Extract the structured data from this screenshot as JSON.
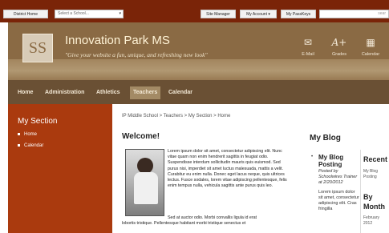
{
  "topbar": {
    "district_home": "District Home",
    "select_school_placeholder": "Select a School...",
    "site_manager": "Site Manager",
    "my_account": "My Account",
    "my_passkeys": "My PassKeys",
    "search_label": "sear"
  },
  "header": {
    "logo_text": "SS",
    "site_title": "Innovation Park MS",
    "tagline": "\"Give your website a fun, unique, and refreshing new look\"",
    "icons": [
      {
        "name": "email-icon",
        "label": "E-Mail"
      },
      {
        "name": "grades-icon",
        "label": "Grades"
      },
      {
        "name": "calendar-icon",
        "label": "Calendar"
      }
    ]
  },
  "nav": {
    "items": [
      {
        "label": "Home"
      },
      {
        "label": "Administration"
      },
      {
        "label": "Athletics"
      },
      {
        "label": "Teachers",
        "active": true
      },
      {
        "label": "Calendar"
      }
    ]
  },
  "sidebar": {
    "title": "My Section",
    "items": [
      {
        "label": "Home"
      },
      {
        "label": "Calendar"
      }
    ]
  },
  "main": {
    "breadcrumb": "IP Middle School > Teachers > My Section > Home",
    "welcome": "Welcome!",
    "paragraph1": "Lorem ipsum dolor sit amet, consectetur adipiscing elit. Nunc vitae quam non enim hendrerit sagittis in feugiat odio. Suspendisse interdum sollicitudin mauris quis euismod. Sed purus nisi, imperdiet sit amet luctus malesuada, mattis a velit. Curabitur eu enim nulla. Donec eget lacus neque, quis ultrices lectus. Fusce sodales, lorem vitae adipiscing pellentesque, felis enim tempus nulla, vehicula sagittis ante purus quis leo.",
    "paragraph2": "Sed at auctor odio. Morbi convallis ligula id erat",
    "paragraph3": "lobortis tristique. Pellentesque habitant morbi tristique senectus et"
  },
  "blog": {
    "title": "My Blog",
    "post": {
      "title": "My Blog Posting",
      "meta": "Posted by Schoolwires Trainer at 2/20/2012",
      "excerpt": "Lorem ipsum dolor sit amet, consectetur adipiscing elit. Cras fringilla"
    },
    "recent_title": "Recent",
    "recent_item": "My Blog Posting",
    "by_month_title": "By Month",
    "month_item": "February 2012"
  }
}
